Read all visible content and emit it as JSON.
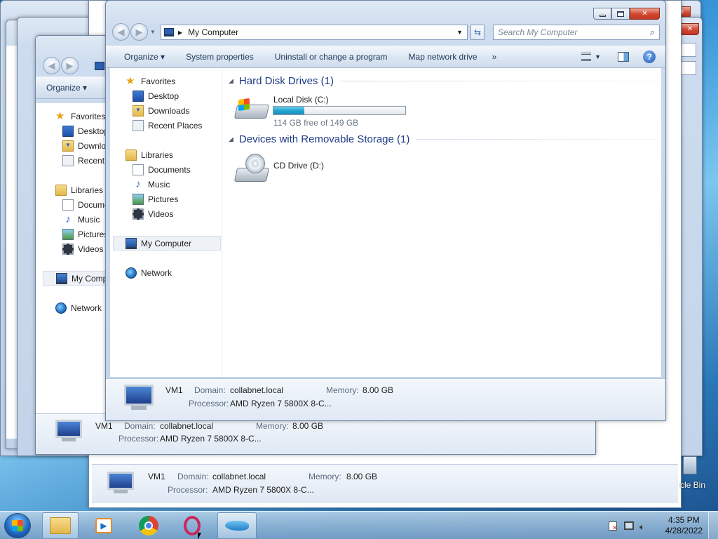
{
  "main": {
    "title": "My Computer",
    "search_placeholder": "Search My Computer",
    "toolbar": {
      "organize": "Organize ▾",
      "system_properties": "System properties",
      "uninstall": "Uninstall or change a program",
      "map_drive": "Map network drive",
      "more": "»"
    },
    "nav": {
      "favorites": "Favorites",
      "desktop": "Desktop",
      "downloads": "Downloads",
      "recent": "Recent Places",
      "libraries": "Libraries",
      "documents": "Documents",
      "music": "Music",
      "pictures": "Pictures",
      "videos": "Videos",
      "my_computer": "My Computer",
      "network": "Network"
    },
    "groups": {
      "hard_disks": "Hard Disk Drives (1)",
      "removable": "Devices with Removable Storage (1)"
    },
    "drives": {
      "local_disk": {
        "name": "Local Disk (C:)",
        "free_text": "114 GB free of 149 GB",
        "used_fraction": 0.235
      },
      "cd_drive": {
        "name": "CD Drive (D:)"
      }
    },
    "details": {
      "name": "VM1",
      "domain_label": "Domain:",
      "domain": "collabnet.local",
      "memory_label": "Memory:",
      "memory": "8.00 GB",
      "processor_label": "Processor:",
      "processor": "AMD Ryzen 7 5800X 8-C..."
    }
  },
  "back_window": {
    "organize": "Organize ▾",
    "nav": {
      "favorites": "Favorites",
      "desktop": "Desktop",
      "downloads": "Downlo",
      "recent": "Recent",
      "libraries": "Libraries",
      "documents": "Docume",
      "music": "Music",
      "pictures": "Pictures",
      "videos": "Videos",
      "my_computer": "My Comp",
      "network": "Network"
    },
    "details": {
      "name": "VM1",
      "domain_label": "Domain:",
      "domain": "collabnet.local",
      "memory_label": "Memory:",
      "memory": "8.00 GB",
      "processor_label": "Processor:",
      "processor": "AMD Ryzen 7 5800X 8-C..."
    }
  },
  "bottom_window": {
    "details": {
      "name": "VM1",
      "domain_label": "Domain:",
      "domain": "collabnet.local",
      "memory_label": "Memory:",
      "memory": "8.00 GB",
      "processor_label": "Processor:",
      "processor": "AMD Ryzen 7 5800X 8-C..."
    }
  },
  "desktop": {
    "recycle_bin_label": "cle Bin"
  },
  "taskbar": {
    "time": "4:35 PM",
    "date": "4/28/2022",
    "apps": [
      "windows-explorer",
      "media-player",
      "chrome",
      "opera",
      "dolphin"
    ]
  }
}
